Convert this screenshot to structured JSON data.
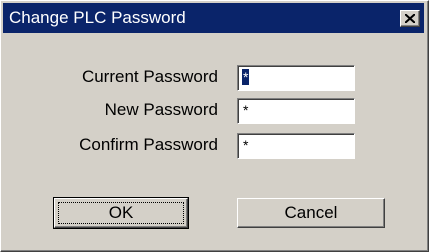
{
  "window": {
    "title": "Change PLC Password",
    "close_icon": "close-icon"
  },
  "form": {
    "current_password": {
      "label": "Current Password",
      "value": "*"
    },
    "new_password": {
      "label": "New Password",
      "value": "*"
    },
    "confirm_password": {
      "label": "Confirm Password",
      "value": "*"
    }
  },
  "buttons": {
    "ok_label": "OK",
    "cancel_label": "Cancel"
  },
  "colors": {
    "titlebar": "#0a246a",
    "dialog_background": "#d4d0c8",
    "selection": "#0a246a"
  }
}
